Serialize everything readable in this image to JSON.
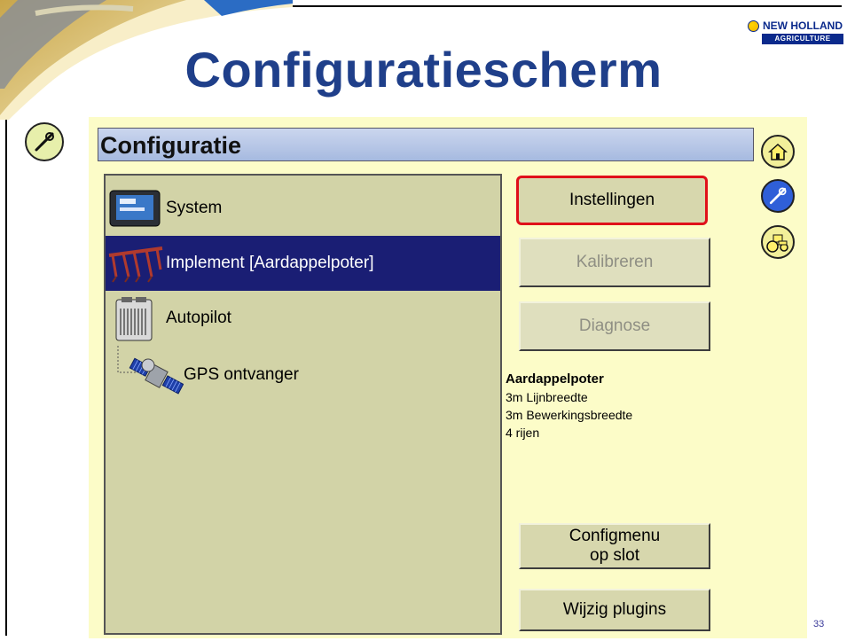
{
  "slide": {
    "title": "Configuratiescherm",
    "page_number": "33",
    "logo": {
      "brand": "NEW HOLLAND",
      "sub": "AGRICULTURE"
    }
  },
  "screen": {
    "title": "Configuratie",
    "tree": [
      {
        "label": "System",
        "icon": "display-icon",
        "selected": false
      },
      {
        "label": "Implement [Aardappelpoter]",
        "icon": "implement-icon",
        "selected": true
      },
      {
        "label": "Autopilot",
        "icon": "autopilot-controller-icon",
        "selected": false
      },
      {
        "label": "GPS ontvanger",
        "icon": "gps-satellite-icon",
        "selected": false
      }
    ],
    "buttons": {
      "instellingen": "Instellingen",
      "kalibreren": "Kalibreren",
      "diagnose": "Diagnose",
      "configmenu_line1": "Configmenu",
      "configmenu_line2": "op slot",
      "wijzig_plugins": "Wijzig plugins"
    },
    "info": {
      "title": "Aardappelpoter",
      "lines": [
        "3m Lijnbreedte",
        "3m Bewerkingsbreedte",
        "4 rijen"
      ]
    },
    "nav": [
      "home-icon",
      "tools-icon",
      "tractor-icon"
    ],
    "colors": {
      "screen_bg": "#fcfcc8",
      "selected_row": "#1a1e74",
      "highlight_border": "#e0101a",
      "title_bar": "#b9c8e8"
    }
  }
}
